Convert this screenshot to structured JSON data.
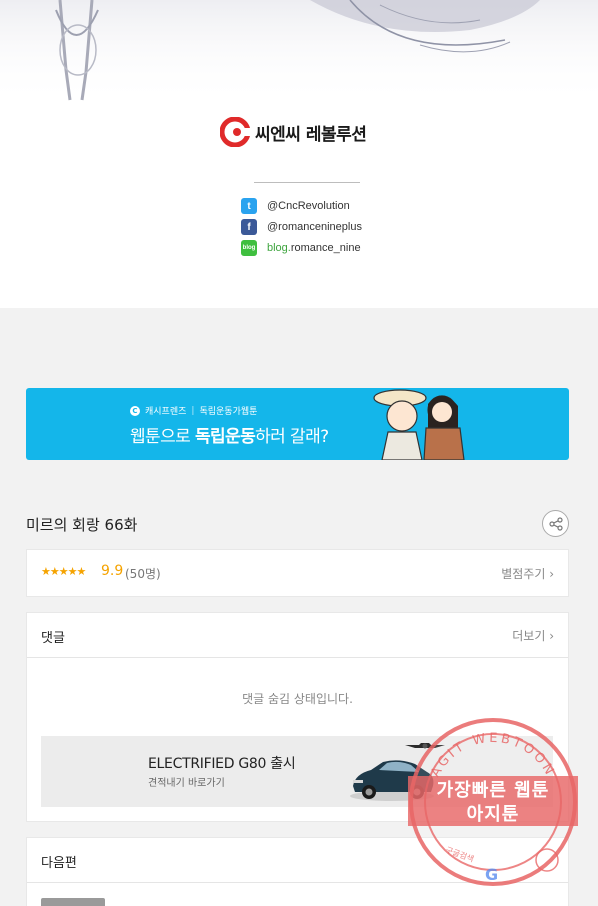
{
  "publisher": {
    "name": "씨엔씨 레볼루션",
    "social": [
      {
        "icon": "twitter-icon",
        "text": "@CncRevolution"
      },
      {
        "icon": "facebook-icon",
        "text": "@romancenineplus"
      },
      {
        "icon": "blog-icon",
        "icon_text": "blog",
        "prefix": "blog.",
        "text": "romance_nine"
      }
    ]
  },
  "banner": {
    "brand": "캐시프렌즈",
    "tag": "독립운동가웹툰",
    "headline_pre": "웹툰으로 ",
    "headline_bold": "독립운동",
    "headline_post": "하러 갈래?"
  },
  "episode": {
    "title": "미르의 회랑 66화",
    "stars": "★★★★★",
    "score": "9.9",
    "votes": "(50명)",
    "rate_label": "별점주기 ›"
  },
  "comments": {
    "label": "댓글",
    "more_label": "더보기 ›",
    "hidden_message": "댓글 숨김 상태입니다."
  },
  "ad": {
    "title": "ELECTRIFIED G80 출시",
    "subtitle": "견적내기 바로가기"
  },
  "next": {
    "label": "다음편"
  },
  "watermark": {
    "line1": "가장빠른 웹툰",
    "line2": "아지툰",
    "ring_top": "AGIT WEBTOON",
    "ring_left": "구글검색",
    "ring_g": "G"
  },
  "colors": {
    "banner_bg": "#14b6ea",
    "star": "#f5a300",
    "logo_red": "#e02a2a",
    "stamp": "#e86666"
  }
}
